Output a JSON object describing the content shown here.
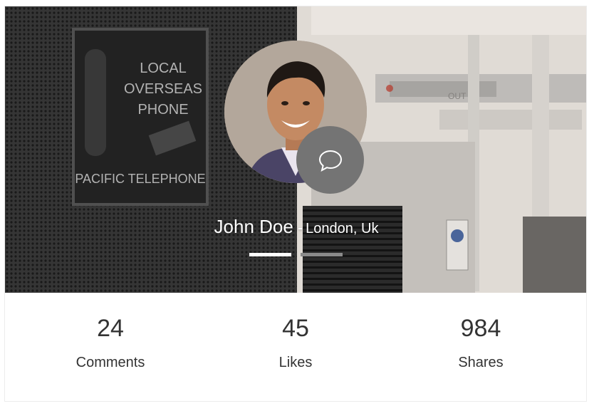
{
  "profile": {
    "name": "John Doe",
    "separator": "-",
    "location": "London, Uk"
  },
  "hero_sign": {
    "line1": "LOCAL",
    "line2": "OVERSEAS",
    "line3": "PHONE",
    "bottom": "PACIFIC TELEPHONE",
    "exit_sign": "OUT"
  },
  "pager": {
    "active_index": 0,
    "count": 2
  },
  "stats": [
    {
      "value": "24",
      "label": "Comments"
    },
    {
      "value": "45",
      "label": "Likes"
    },
    {
      "value": "984",
      "label": "Shares"
    }
  ],
  "icons": {
    "chat": "chat-bubble-icon"
  },
  "colors": {
    "chat_button": "#747474",
    "pager_active": "#ffffff",
    "pager_inactive": "#8a8a8a",
    "stat_text": "#333333"
  }
}
